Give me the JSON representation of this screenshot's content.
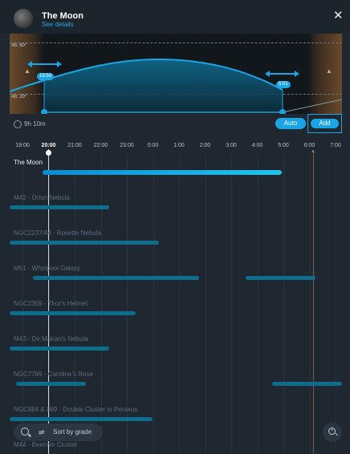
{
  "header": {
    "title": "The Moon",
    "details_link": "See details",
    "close_icon": "close-icon",
    "avatar_icon": "moon-thumbnail"
  },
  "altitude_chart": {
    "upper_label": "Alt. 60°",
    "lower_label": "Alt. 20°",
    "rise_time": "19:50",
    "set_time": "5:01",
    "twilight_color": "#6a4a2c",
    "curve_color": "#1aa6e6"
  },
  "controls": {
    "duration": "9h 10m",
    "auto_label": "Auto",
    "add_label": "Add",
    "accent_color": "#1aa6e6"
  },
  "timeline": {
    "ticks": [
      "19:00",
      "20:00",
      "21:00",
      "22:00",
      "23:00",
      "0:00",
      "1:00",
      "2:00",
      "3:00",
      "4:00",
      "5:00",
      "6:00",
      "7:00"
    ],
    "current_tick": "20:00",
    "rows": [
      {
        "label": "The Moon",
        "highlight": true,
        "bars": [
          [
            0.1,
            0.82
          ]
        ]
      },
      {
        "label": "M42 - Orion Nebula",
        "highlight": false,
        "bars": [
          [
            -0.05,
            0.3
          ]
        ]
      },
      {
        "label": "NGC2237/44 - Rosette Nebula",
        "highlight": false,
        "bars": [
          [
            -0.05,
            0.45
          ]
        ]
      },
      {
        "label": "M51 - Whirlpool Galaxy",
        "highlight": false,
        "bars": [
          [
            0.07,
            0.57
          ],
          [
            0.71,
            0.92
          ]
        ]
      },
      {
        "label": "NGC2359 - Thor's Helmet",
        "highlight": false,
        "bars": [
          [
            -0.05,
            0.38
          ]
        ]
      },
      {
        "label": "M43 - De Mairan's Nebula",
        "highlight": false,
        "bars": [
          [
            -0.05,
            0.3
          ]
        ]
      },
      {
        "label": "NGC7789 - Caroline's Rose",
        "highlight": false,
        "bars": [
          [
            0.02,
            0.23
          ],
          [
            0.79,
            1.05
          ]
        ]
      },
      {
        "label": "NGC884 & 869 - Double Cluster in Perseus",
        "highlight": false,
        "bars": [
          [
            -0.05,
            0.43
          ]
        ]
      },
      {
        "label": "M44 - Beehive Cluster",
        "highlight": false,
        "bars": []
      }
    ]
  },
  "bottom": {
    "sort_label": "Sort by grade",
    "search_icon": "search-icon",
    "sort_icon": "sort-icon",
    "zoom_icon": "zoom-in-icon"
  }
}
